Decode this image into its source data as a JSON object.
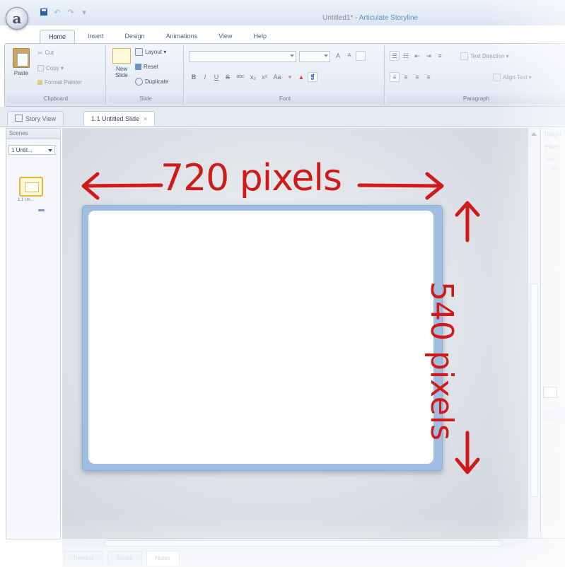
{
  "window": {
    "title_doc": "Untitled1* - ",
    "title_app": "Articulate Storyline",
    "orb_letter": "a"
  },
  "quick_access": {
    "save_icon": "save-icon",
    "undo_glyph": "↶",
    "redo_glyph": "↷",
    "customize_glyph": "▾"
  },
  "ribbon_tabs": [
    {
      "label": "Home",
      "active": true
    },
    {
      "label": "Insert"
    },
    {
      "label": "Design"
    },
    {
      "label": "Animations"
    },
    {
      "label": "View"
    },
    {
      "label": "Help"
    }
  ],
  "ribbon": {
    "clipboard": {
      "label": "Clipboard",
      "paste": "Paste",
      "cut": "Cut",
      "copy": "Copy ▾",
      "format_painter": "Format Painter"
    },
    "slide": {
      "label": "Slide",
      "new_slide_line1": "New",
      "new_slide_line2": "Slide",
      "layout": "Layout ▾",
      "reset": "Reset",
      "duplicate": "Duplicate"
    },
    "font": {
      "label": "Font",
      "grow": "A",
      "shrink": "A",
      "bold": "B",
      "italic": "I",
      "underline": "U",
      "strike": "S",
      "abc": "abc",
      "sub": "x₂",
      "sup": "x²",
      "case": "Aa"
    },
    "paragraph": {
      "label": "Paragraph",
      "text_direction": "Text Direction ▾",
      "align_text": "Align Text ▾"
    }
  },
  "doc_tabs": {
    "story_view": "Story View",
    "slide_tab": "1.1 Untitled Slide",
    "close_glyph": "×"
  },
  "scenes": {
    "header": "Scenes",
    "selected": "1 Untit...",
    "thumb_label": "1.1 Un..."
  },
  "annotations": {
    "width": "720 pixels",
    "height": "540 pixels"
  },
  "right_panel": {
    "title": "Trigger",
    "sub": "Player",
    "line1": "Jum",
    "line2": "Wh"
  },
  "bottom_tabs": [
    {
      "label": "Timeline"
    },
    {
      "label": "States"
    },
    {
      "label": "Notes",
      "active": true
    }
  ],
  "colors": {
    "annotation_red": "#cf1a1a",
    "slide_border_blue": "#a2bde2",
    "ribbon_bg": "#dfe7f1",
    "accent_title": "#5a8fd0"
  }
}
